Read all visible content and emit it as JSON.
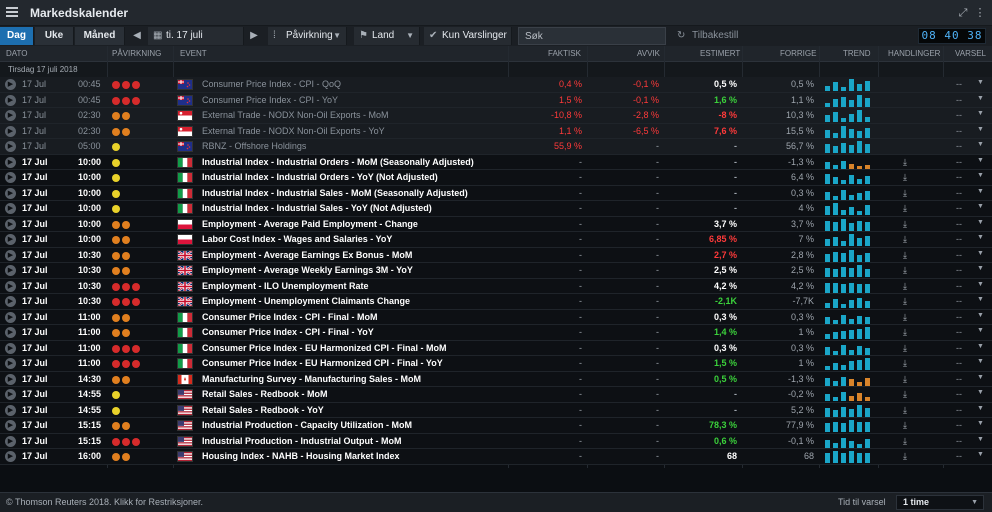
{
  "app": {
    "title": "Markedskalender",
    "clock": "08 40 38"
  },
  "toolbar": {
    "tabs": [
      "Dag",
      "Uke",
      "Måned"
    ],
    "date": "ti. 17 juli",
    "impact_label": "Påvirkning",
    "country_label": "Land",
    "alerts_label": "Kun Varslinger",
    "search_placeholder": "Søk",
    "reset_label": "Tilbakestill"
  },
  "columns": {
    "date": "DATO",
    "impact": "PÅVIRKNING",
    "event": "EVENT",
    "actual": "FAKTISK",
    "deviation": "AVVIK",
    "estimate": "ESTIMERT",
    "previous": "FORRIGE",
    "trend": "TREND",
    "actions": "HANDLINGER",
    "alert": "VARSEL"
  },
  "group_label": "Tirsdag 17 juli 2018",
  "colors": {
    "high": "#d62b2b",
    "medium": "#e07f1f",
    "low": "#e9d22a",
    "trend": "#1aa6c8",
    "trend_neg": "#d9842a"
  },
  "rows": [
    {
      "date": "17 Jul",
      "time": "00:45",
      "impact": "high",
      "flag": "nz",
      "event": "Consumer Price Index - CPI - QoQ",
      "actual": "0,4 %",
      "actual_c": "red",
      "deviation": "-0,1 %",
      "dev_c": "red",
      "estimate": "0,5 %",
      "est_c": "white",
      "previous": "0,5 %",
      "past": true,
      "trend": [
        0.4,
        0.7,
        0.3,
        0.9,
        0.5,
        0.8
      ],
      "neg": false
    },
    {
      "date": "17 Jul",
      "time": "00:45",
      "impact": "high",
      "flag": "nz",
      "event": "Consumer Price Index - CPI - YoY",
      "actual": "1,5 %",
      "actual_c": "red",
      "deviation": "-0,1 %",
      "dev_c": "red",
      "estimate": "1,6 %",
      "est_c": "green",
      "previous": "1,1 %",
      "past": true,
      "trend": [
        0.3,
        0.6,
        0.8,
        0.5,
        0.9,
        0.7
      ],
      "neg": false
    },
    {
      "date": "17 Jul",
      "time": "02:30",
      "impact": "medium",
      "flag": "sg",
      "event": "External Trade - NODX Non-Oil Exports - MoM",
      "actual": "-10,8 %",
      "actual_c": "red",
      "deviation": "-2,8 %",
      "dev_c": "red",
      "estimate": "-8 %",
      "est_c": "red",
      "previous": "10,3 %",
      "past": true,
      "trend": [
        0.5,
        0.8,
        0.3,
        0.6,
        0.9,
        0.4
      ],
      "neg": false
    },
    {
      "date": "17 Jul",
      "time": "02:30",
      "impact": "medium",
      "flag": "sg",
      "event": "External Trade - NODX Non-Oil Exports - YoY",
      "actual": "1,1 %",
      "actual_c": "red",
      "deviation": "-6,5 %",
      "dev_c": "red",
      "estimate": "7,6 %",
      "est_c": "red",
      "previous": "15,5 %",
      "past": true,
      "trend": [
        0.6,
        0.4,
        0.9,
        0.7,
        0.5,
        0.8
      ],
      "neg": false
    },
    {
      "date": "17 Jul",
      "time": "05:00",
      "impact": "low",
      "flag": "nz",
      "event": "RBNZ - Offshore Holdings",
      "actual": "55,9 %",
      "actual_c": "red",
      "deviation": "-",
      "dev_c": "grey",
      "estimate": "-",
      "est_c": "grey",
      "previous": "56,7 %",
      "past": true,
      "trend": [
        0.7,
        0.5,
        0.8,
        0.6,
        0.9,
        0.7
      ],
      "neg": false
    },
    {
      "date": "17 Jul",
      "time": "10:00",
      "impact": "low",
      "flag": "it",
      "event": "Industrial Index - Industrial Orders - MoM (Seasonally Adjusted)",
      "actual": "-",
      "actual_c": "grey",
      "deviation": "-",
      "dev_c": "grey",
      "estimate": "-",
      "est_c": "grey",
      "previous": "-1,3 %",
      "past": false,
      "trend": [
        0.5,
        0.3,
        0.6,
        0.4,
        0.2,
        0.3
      ],
      "neg": true
    },
    {
      "date": "17 Jul",
      "time": "10:00",
      "impact": "low",
      "flag": "it",
      "event": "Industrial Index - Industrial Orders - YoY (Not Adjusted)",
      "actual": "-",
      "actual_c": "grey",
      "deviation": "-",
      "dev_c": "grey",
      "estimate": "-",
      "est_c": "grey",
      "previous": "6,4 %",
      "past": false,
      "trend": [
        0.8,
        0.5,
        0.3,
        0.7,
        0.4,
        0.6
      ],
      "neg": false
    },
    {
      "date": "17 Jul",
      "time": "10:00",
      "impact": "low",
      "flag": "it",
      "event": "Industrial Index - Industrial Sales - MoM (Seasonally Adjusted)",
      "actual": "-",
      "actual_c": "grey",
      "deviation": "-",
      "dev_c": "grey",
      "estimate": "-",
      "est_c": "grey",
      "previous": "0,3 %",
      "past": false,
      "trend": [
        0.6,
        0.3,
        0.8,
        0.4,
        0.5,
        0.7
      ],
      "neg": false
    },
    {
      "date": "17 Jul",
      "time": "10:00",
      "impact": "low",
      "flag": "it",
      "event": "Industrial Index - Industrial Sales - YoY (Not Adjusted)",
      "actual": "-",
      "actual_c": "grey",
      "deviation": "-",
      "dev_c": "grey",
      "estimate": "-",
      "est_c": "grey",
      "previous": "4 %",
      "past": false,
      "trend": [
        0.7,
        0.9,
        0.4,
        0.6,
        0.3,
        0.8
      ],
      "neg": false
    },
    {
      "date": "17 Jul",
      "time": "10:00",
      "impact": "medium",
      "flag": "pl",
      "event": "Employment - Average Paid Employment - Change",
      "actual": "-",
      "actual_c": "grey",
      "deviation": "-",
      "dev_c": "grey",
      "estimate": "3,7 %",
      "est_c": "white",
      "previous": "3,7 %",
      "past": false,
      "trend": [
        0.8,
        0.7,
        0.9,
        0.6,
        0.8,
        0.7
      ],
      "neg": false
    },
    {
      "date": "17 Jul",
      "time": "10:00",
      "impact": "medium",
      "flag": "pl",
      "event": "Labor Cost Index - Wages and Salaries - YoY",
      "actual": "-",
      "actual_c": "grey",
      "deviation": "-",
      "dev_c": "grey",
      "estimate": "6,85 %",
      "est_c": "red",
      "previous": "7 %",
      "past": false,
      "trend": [
        0.5,
        0.7,
        0.4,
        0.9,
        0.6,
        0.8
      ],
      "neg": false
    },
    {
      "date": "17 Jul",
      "time": "10:30",
      "impact": "medium",
      "flag": "gb",
      "event": "Employment - Average Earnings Ex Bonus - MoM",
      "actual": "-",
      "actual_c": "grey",
      "deviation": "-",
      "dev_c": "grey",
      "estimate": "2,7 %",
      "est_c": "red",
      "previous": "2,8 %",
      "past": false,
      "trend": [
        0.6,
        0.8,
        0.7,
        0.9,
        0.5,
        0.7
      ],
      "neg": false
    },
    {
      "date": "17 Jul",
      "time": "10:30",
      "impact": "medium",
      "flag": "gb",
      "event": "Employment - Average Weekly Earnings 3M - YoY",
      "actual": "-",
      "actual_c": "grey",
      "deviation": "-",
      "dev_c": "grey",
      "estimate": "2,5 %",
      "est_c": "white",
      "previous": "2,5 %",
      "past": false,
      "trend": [
        0.7,
        0.6,
        0.8,
        0.7,
        0.9,
        0.6
      ],
      "neg": false
    },
    {
      "date": "17 Jul",
      "time": "10:30",
      "impact": "high",
      "flag": "gb",
      "event": "Employment - ILO Unemployment Rate",
      "actual": "-",
      "actual_c": "grey",
      "deviation": "-",
      "dev_c": "grey",
      "estimate": "4,2 %",
      "est_c": "white",
      "previous": "4,2 %",
      "past": false,
      "trend": [
        0.8,
        0.8,
        0.7,
        0.8,
        0.7,
        0.7
      ],
      "neg": false
    },
    {
      "date": "17 Jul",
      "time": "10:30",
      "impact": "high",
      "flag": "gb",
      "event": "Employment - Unemployment Claimants Change",
      "actual": "-",
      "actual_c": "grey",
      "deviation": "-",
      "dev_c": "grey",
      "estimate": "-2,1K",
      "est_c": "green",
      "previous": "-7,7K",
      "past": false,
      "trend": [
        0.4,
        0.7,
        0.3,
        0.6,
        0.8,
        0.5
      ],
      "neg": false
    },
    {
      "date": "17 Jul",
      "time": "11:00",
      "impact": "medium",
      "flag": "it",
      "event": "Consumer Price Index - CPI - Final - MoM",
      "actual": "-",
      "actual_c": "grey",
      "deviation": "-",
      "dev_c": "grey",
      "estimate": "0,3 %",
      "est_c": "white",
      "previous": "0,3 %",
      "past": false,
      "trend": [
        0.5,
        0.3,
        0.7,
        0.4,
        0.6,
        0.5
      ],
      "neg": false
    },
    {
      "date": "17 Jul",
      "time": "11:00",
      "impact": "medium",
      "flag": "it",
      "event": "Consumer Price Index - CPI - Final - YoY",
      "actual": "-",
      "actual_c": "grey",
      "deviation": "-",
      "dev_c": "grey",
      "estimate": "1,4 %",
      "est_c": "green",
      "previous": "1 %",
      "past": false,
      "trend": [
        0.4,
        0.5,
        0.6,
        0.7,
        0.8,
        0.9
      ],
      "neg": false
    },
    {
      "date": "17 Jul",
      "time": "11:00",
      "impact": "high",
      "flag": "it",
      "event": "Consumer Price Index - EU Harmonized CPI - Final - MoM",
      "actual": "-",
      "actual_c": "grey",
      "deviation": "-",
      "dev_c": "grey",
      "estimate": "0,3 %",
      "est_c": "white",
      "previous": "0,3 %",
      "past": false,
      "trend": [
        0.6,
        0.3,
        0.8,
        0.4,
        0.7,
        0.5
      ],
      "neg": false
    },
    {
      "date": "17 Jul",
      "time": "11:00",
      "impact": "high",
      "flag": "it",
      "event": "Consumer Price Index - EU Harmonized CPI - Final - YoY",
      "actual": "-",
      "actual_c": "grey",
      "deviation": "-",
      "dev_c": "grey",
      "estimate": "1,5 %",
      "est_c": "green",
      "previous": "1 %",
      "past": false,
      "trend": [
        0.3,
        0.5,
        0.4,
        0.7,
        0.8,
        0.9
      ],
      "neg": false
    },
    {
      "date": "17 Jul",
      "time": "14:30",
      "impact": "medium",
      "flag": "ca",
      "event": "Manufacturing Survey - Manufacturing Sales - MoM",
      "actual": "-",
      "actual_c": "grey",
      "deviation": "-",
      "dev_c": "grey",
      "estimate": "0,5 %",
      "est_c": "green",
      "previous": "-1,3 %",
      "past": false,
      "trend": [
        0.6,
        0.4,
        0.7,
        0.5,
        0.3,
        0.6
      ],
      "neg": true
    },
    {
      "date": "17 Jul",
      "time": "14:55",
      "impact": "low",
      "flag": "us",
      "event": "Retail Sales - Redbook - MoM",
      "actual": "-",
      "actual_c": "grey",
      "deviation": "-",
      "dev_c": "grey",
      "estimate": "-",
      "est_c": "grey",
      "previous": "-0,2 %",
      "past": false,
      "trend": [
        0.5,
        0.3,
        0.7,
        0.4,
        0.6,
        0.3
      ],
      "neg": true
    },
    {
      "date": "17 Jul",
      "time": "14:55",
      "impact": "low",
      "flag": "us",
      "event": "Retail Sales - Redbook - YoY",
      "actual": "-",
      "actual_c": "grey",
      "deviation": "-",
      "dev_c": "grey",
      "estimate": "-",
      "est_c": "grey",
      "previous": "5,2 %",
      "past": false,
      "trend": [
        0.7,
        0.5,
        0.8,
        0.6,
        0.9,
        0.7
      ],
      "neg": false
    },
    {
      "date": "17 Jul",
      "time": "15:15",
      "impact": "medium",
      "flag": "us",
      "event": "Industrial Production - Capacity Utilization - MoM",
      "actual": "-",
      "actual_c": "grey",
      "deviation": "-",
      "dev_c": "grey",
      "estimate": "78,3 %",
      "est_c": "green",
      "previous": "77,9 %",
      "past": false,
      "trend": [
        0.7,
        0.8,
        0.7,
        0.9,
        0.8,
        0.8
      ],
      "neg": false
    },
    {
      "date": "17 Jul",
      "time": "15:15",
      "impact": "high",
      "flag": "us",
      "event": "Industrial Production - Industrial Output - MoM",
      "actual": "-",
      "actual_c": "grey",
      "deviation": "-",
      "dev_c": "grey",
      "estimate": "0,6 %",
      "est_c": "green",
      "previous": "-0,1 %",
      "past": false,
      "trend": [
        0.6,
        0.4,
        0.8,
        0.5,
        0.3,
        0.7
      ],
      "neg": false
    },
    {
      "date": "17 Jul",
      "time": "16:00",
      "impact": "medium",
      "flag": "us",
      "event": "Housing Index - NAHB - Housing Market Index",
      "actual": "-",
      "actual_c": "grey",
      "deviation": "-",
      "dev_c": "grey",
      "estimate": "68",
      "est_c": "white",
      "previous": "68",
      "past": false,
      "trend": [
        0.8,
        0.9,
        0.8,
        0.9,
        0.8,
        0.8
      ],
      "neg": false
    }
  ],
  "row_alert": "--",
  "footer": {
    "copyright": "© Thomson Reuters 2018. Klikk for Restriksjoner.",
    "alert_label": "Tid til varsel",
    "alert_value": "1 time"
  }
}
